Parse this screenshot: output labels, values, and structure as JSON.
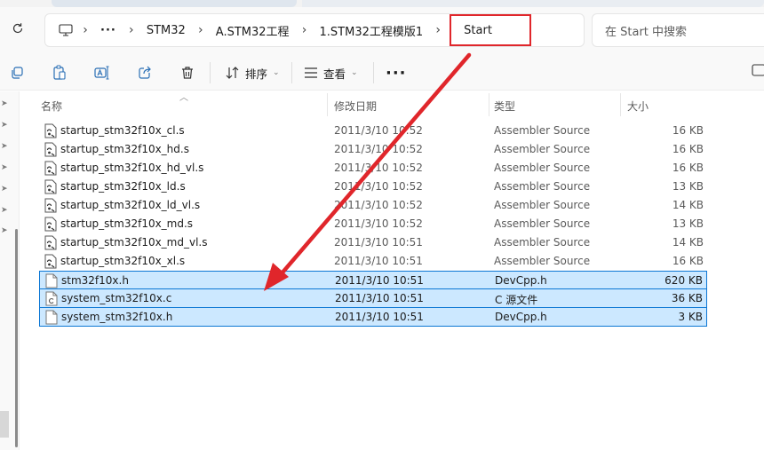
{
  "breadcrumbs": [
    "STM32",
    "A.STM32工程",
    "1.STM32工程模版1"
  ],
  "current_folder": "Start",
  "more_crumbs": "···",
  "search": {
    "placeholder": "在 Start 中搜索"
  },
  "toolbar": {
    "sort_label": "排序",
    "view_label": "查看",
    "more_label": "···"
  },
  "columns": {
    "name": "名称",
    "date": "修改日期",
    "type": "类型",
    "size": "大小"
  },
  "files": [
    {
      "name": "startup_stm32f10x_cl.s",
      "date": "2011/3/10 10:52",
      "type": "Assembler Source",
      "size": "16 KB",
      "icon": "assembler-file-icon",
      "selected": false
    },
    {
      "name": "startup_stm32f10x_hd.s",
      "date": "2011/3/10 10:52",
      "type": "Assembler Source",
      "size": "16 KB",
      "icon": "assembler-file-icon",
      "selected": false
    },
    {
      "name": "startup_stm32f10x_hd_vl.s",
      "date": "2011/3/10 10:52",
      "type": "Assembler Source",
      "size": "16 KB",
      "icon": "assembler-file-icon",
      "selected": false
    },
    {
      "name": "startup_stm32f10x_ld.s",
      "date": "2011/3/10 10:52",
      "type": "Assembler Source",
      "size": "13 KB",
      "icon": "assembler-file-icon",
      "selected": false
    },
    {
      "name": "startup_stm32f10x_ld_vl.s",
      "date": "2011/3/10 10:52",
      "type": "Assembler Source",
      "size": "14 KB",
      "icon": "assembler-file-icon",
      "selected": false
    },
    {
      "name": "startup_stm32f10x_md.s",
      "date": "2011/3/10 10:52",
      "type": "Assembler Source",
      "size": "13 KB",
      "icon": "assembler-file-icon",
      "selected": false
    },
    {
      "name": "startup_stm32f10x_md_vl.s",
      "date": "2011/3/10 10:51",
      "type": "Assembler Source",
      "size": "14 KB",
      "icon": "assembler-file-icon",
      "selected": false
    },
    {
      "name": "startup_stm32f10x_xl.s",
      "date": "2011/3/10 10:51",
      "type": "Assembler Source",
      "size": "16 KB",
      "icon": "assembler-file-icon",
      "selected": false
    },
    {
      "name": "stm32f10x.h",
      "date": "2011/3/10 10:51",
      "type": "DevCpp.h",
      "size": "620 KB",
      "icon": "header-file-icon",
      "selected": true
    },
    {
      "name": "system_stm32f10x.c",
      "date": "2011/3/10 10:51",
      "type": "C 源文件",
      "size": "36 KB",
      "icon": "c-source-file-icon",
      "selected": true
    },
    {
      "name": "system_stm32f10x.h",
      "date": "2011/3/10 10:51",
      "type": "DevCpp.h",
      "size": "3 KB",
      "icon": "header-file-icon",
      "selected": true
    }
  ],
  "colors": {
    "selection_fill": "#cce8ff",
    "selection_border": "#0c77d4",
    "annotation_red": "#e0262b"
  }
}
